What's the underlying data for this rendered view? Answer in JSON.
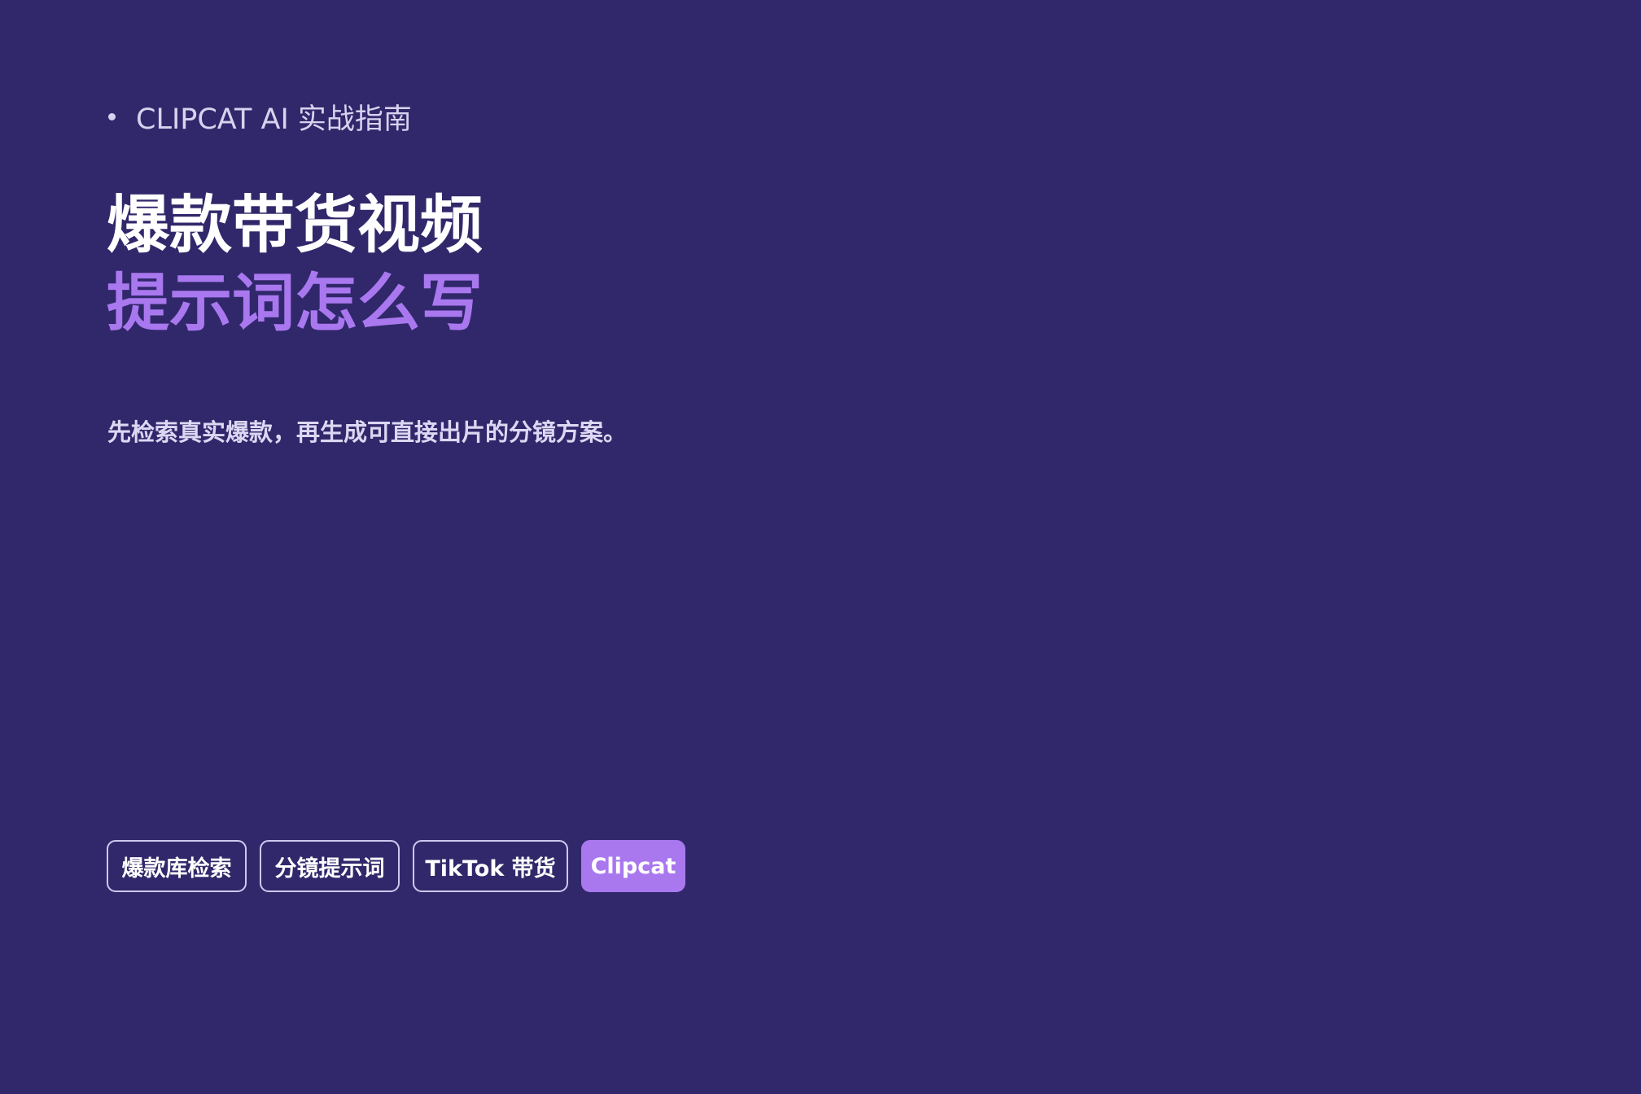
{
  "eyebrow": {
    "text": "CLIPCAT AI 实战指南"
  },
  "headline": {
    "line1": "爆款带货视频",
    "line2": "提示词怎么写"
  },
  "subtitle": "先检索真实爆款，再生成可直接出片的分镜方案。",
  "tags": [
    {
      "label": "爆款库检索"
    },
    {
      "label": "分镜提示词"
    },
    {
      "label": "TikTok 带货"
    },
    {
      "label": "Clipcat"
    }
  ],
  "colors": {
    "background": "#31286b",
    "accent": "#a978ef",
    "white": "#ffffff",
    "muted_text": "#ddd7f3"
  }
}
